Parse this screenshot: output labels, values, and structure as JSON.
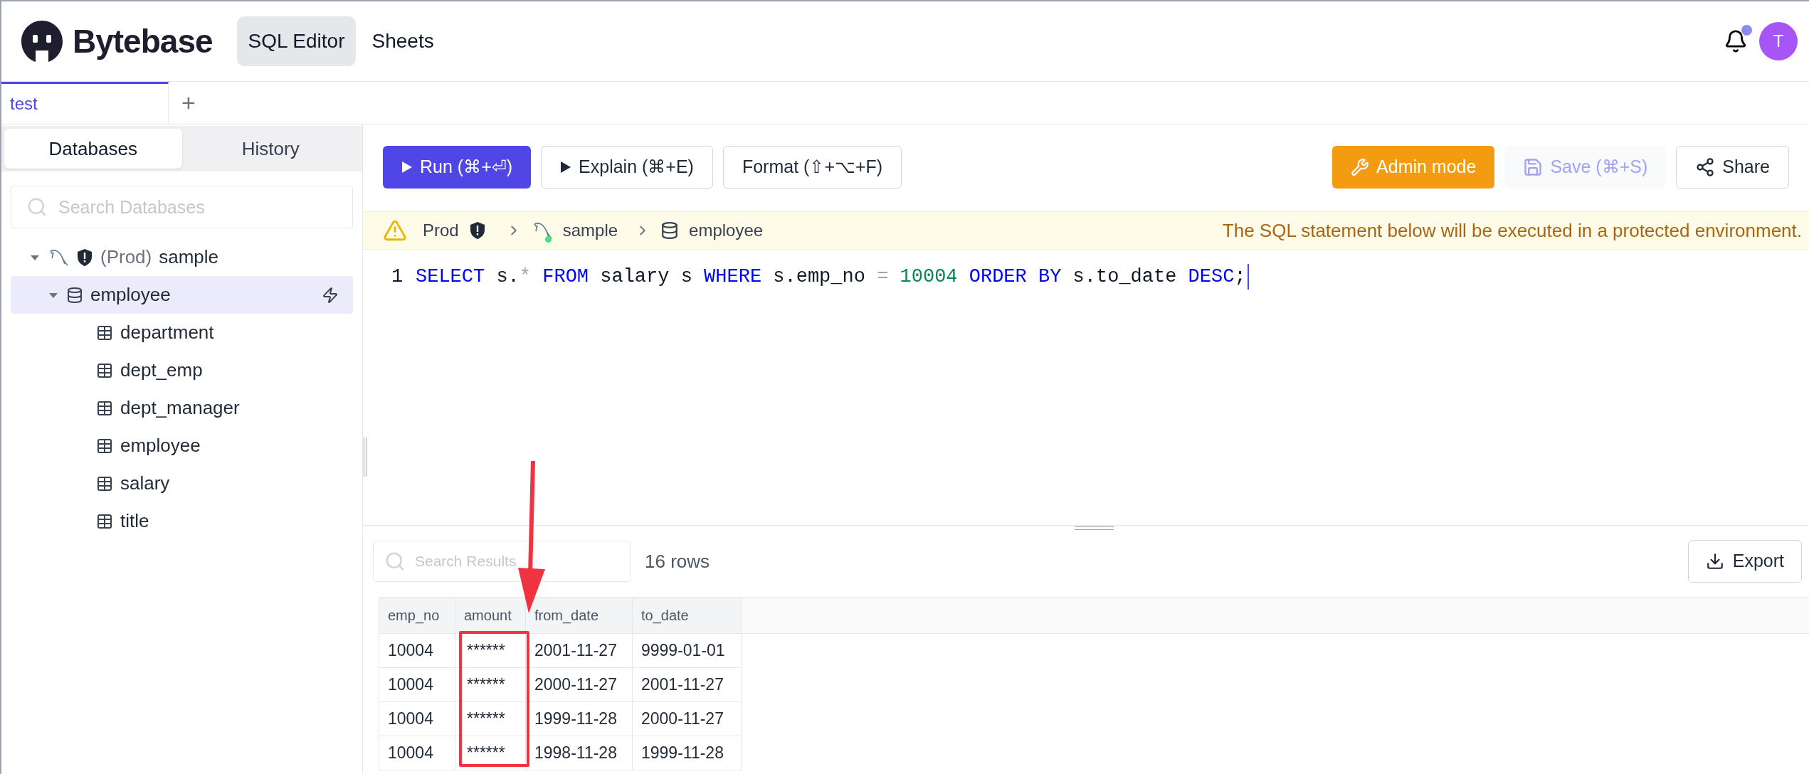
{
  "header": {
    "logo_text": "Bytebase",
    "nav": [
      {
        "label": "SQL Editor",
        "selected": true
      },
      {
        "label": "Sheets",
        "selected": false
      }
    ],
    "notifications": {
      "unread": true
    },
    "avatar": {
      "initial": "T"
    }
  },
  "tabs": [
    {
      "label": "test",
      "selected": true
    }
  ],
  "new_tab": {
    "label": "+"
  },
  "sidebar": {
    "tabs": [
      {
        "label": "Databases",
        "selected": true
      },
      {
        "label": "History",
        "selected": false
      }
    ],
    "search": {
      "placeholder": "Search Databases"
    },
    "tree": [
      {
        "kind": "instance",
        "environment": "(Prod)",
        "label": "sample",
        "expanded": true,
        "selected": false,
        "children": [
          {
            "kind": "database",
            "label": "employee",
            "expanded": true,
            "selected": true,
            "children": [
              {
                "kind": "table",
                "label": "department",
                "selected": false
              },
              {
                "kind": "table",
                "label": "dept_emp",
                "selected": false
              },
              {
                "kind": "table",
                "label": "dept_manager",
                "selected": false
              },
              {
                "kind": "table",
                "label": "employee",
                "selected": false
              },
              {
                "kind": "table",
                "label": "salary",
                "selected": false
              },
              {
                "kind": "table",
                "label": "title",
                "selected": false
              }
            ]
          }
        ]
      }
    ]
  },
  "toolbar": {
    "left": [
      {
        "kind": "run",
        "label": "Run (⌘+⏎)",
        "disabled": false
      },
      {
        "kind": "explain",
        "label": "Explain (⌘+E)",
        "disabled": false
      },
      {
        "kind": "format",
        "label": "Format (⇧+⌥+F)",
        "disabled": false
      }
    ],
    "right": [
      {
        "kind": "admin",
        "label": "Admin mode",
        "disabled": false
      },
      {
        "kind": "save",
        "label": "Save (⌘+S)",
        "disabled": true
      },
      {
        "kind": "share",
        "label": "Share",
        "disabled": false
      }
    ]
  },
  "context_bar": {
    "environment": "Prod",
    "instance": "sample",
    "database_name": "employee",
    "message": "The SQL statement below will be executed in a protected environment."
  },
  "editor": {
    "lines": [
      {
        "number": "1",
        "tokens": [
          {
            "kind": "keyword",
            "text": "SELECT"
          },
          {
            "kind": "plain",
            "text": " s."
          },
          {
            "kind": "operator",
            "text": "*"
          },
          {
            "kind": "keyword",
            "text": " FROM"
          },
          {
            "kind": "plain",
            "text": " salary s "
          },
          {
            "kind": "keyword",
            "text": "WHERE"
          },
          {
            "kind": "plain",
            "text": " s.emp_no "
          },
          {
            "kind": "operator",
            "text": "="
          },
          {
            "kind": "number",
            "text": " 10004"
          },
          {
            "kind": "keyword",
            "text": " ORDER BY"
          },
          {
            "kind": "plain",
            "text": " s.to_date "
          },
          {
            "kind": "keyword",
            "text": "DESC"
          },
          {
            "kind": "plain",
            "text": ";"
          }
        ]
      }
    ]
  },
  "results": {
    "search": {
      "placeholder": "Search Results"
    },
    "row_count": "16 rows",
    "export": "Export",
    "table": {
      "columns": [
        "emp_no",
        "amount",
        "from_date",
        "to_date"
      ],
      "rows": [
        [
          "10004",
          "******",
          "2001-11-27",
          "9999-01-01"
        ],
        [
          "10004",
          "******",
          "2000-11-27",
          "2001-11-27"
        ],
        [
          "10004",
          "******",
          "1999-11-28",
          "2000-11-27"
        ],
        [
          "10004",
          "******",
          "1998-11-28",
          "1999-11-28"
        ]
      ]
    }
  }
}
